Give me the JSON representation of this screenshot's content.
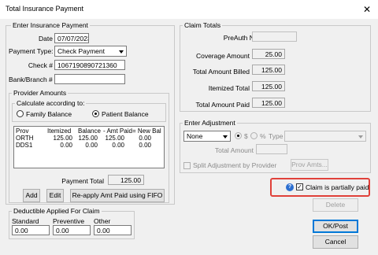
{
  "window": {
    "title": "Total Insurance Payment",
    "close_glyph": "✕"
  },
  "enter_payment": {
    "title": "Enter Insurance Payment",
    "date_label": "Date",
    "date_value": "07/07/2023",
    "payment_type_label": "Payment Type:",
    "payment_type_value": "Check Payment",
    "check_label": "Check #",
    "check_value": "1067190890721360",
    "bank_label": "Bank/Branch #",
    "bank_value": ""
  },
  "provider_amounts": {
    "title": "Provider Amounts",
    "calc_title": "Calculate according to:",
    "family_balance": "Family Balance",
    "patient_balance": "Patient Balance",
    "selected": "patient_balance",
    "columns": {
      "prov": "Prov",
      "itemized": "Itemized",
      "balance": "Balance",
      "amt_paid": "- Amt Paid",
      "new_bal": "= New Bal"
    },
    "rows": [
      {
        "prov": "ORTH",
        "itemized": "125.00",
        "balance": "125.00",
        "amt_paid": "125.00",
        "new_bal": "0.00"
      },
      {
        "prov": "DDS1",
        "itemized": "0.00",
        "balance": "0.00",
        "amt_paid": "0.00",
        "new_bal": "0.00"
      }
    ],
    "payment_total_label": "Payment Total",
    "payment_total_value": "125.00",
    "add_label": "Add",
    "edit_label": "Edit",
    "reapply_label": "Re-apply Amt Paid using FIFO"
  },
  "deductible": {
    "title": "Deductible Applied For Claim",
    "standard_label": "Standard",
    "standard_value": "0.00",
    "preventive_label": "Preventive",
    "preventive_value": "0.00",
    "other_label": "Other",
    "other_value": "0.00"
  },
  "claim_totals": {
    "title": "Claim Totals",
    "preauth_label": "PreAuth Number",
    "preauth_value": "",
    "coverage_label": "Coverage Amount",
    "coverage_value": "25.00",
    "billed_label": "Total Amount Billed",
    "billed_value": "125.00",
    "itemized_label": "Itemized Total",
    "itemized_value": "125.00",
    "paid_label": "Total Amount Paid",
    "paid_value": "125.00"
  },
  "adjustment": {
    "title": "Enter Adjustment",
    "type_value": "None",
    "dollar_label": "$",
    "percent_label": "%",
    "type_label": "Type",
    "type_select_value": "",
    "total_amount_label": "Total Amount",
    "total_amount_value": "",
    "split_label": "Split Adjustment by Provider",
    "prov_amts_label": "Prov Amts..."
  },
  "partial": {
    "label": "Claim is partially paid",
    "checked": true,
    "help_glyph": "?"
  },
  "buttons": {
    "delete": "Delete",
    "ok": "OK/Post",
    "cancel": "Cancel"
  },
  "colors": {
    "highlight": "#e0413a",
    "help_icon": "#2c6fd0",
    "focus": "#0078d7"
  }
}
